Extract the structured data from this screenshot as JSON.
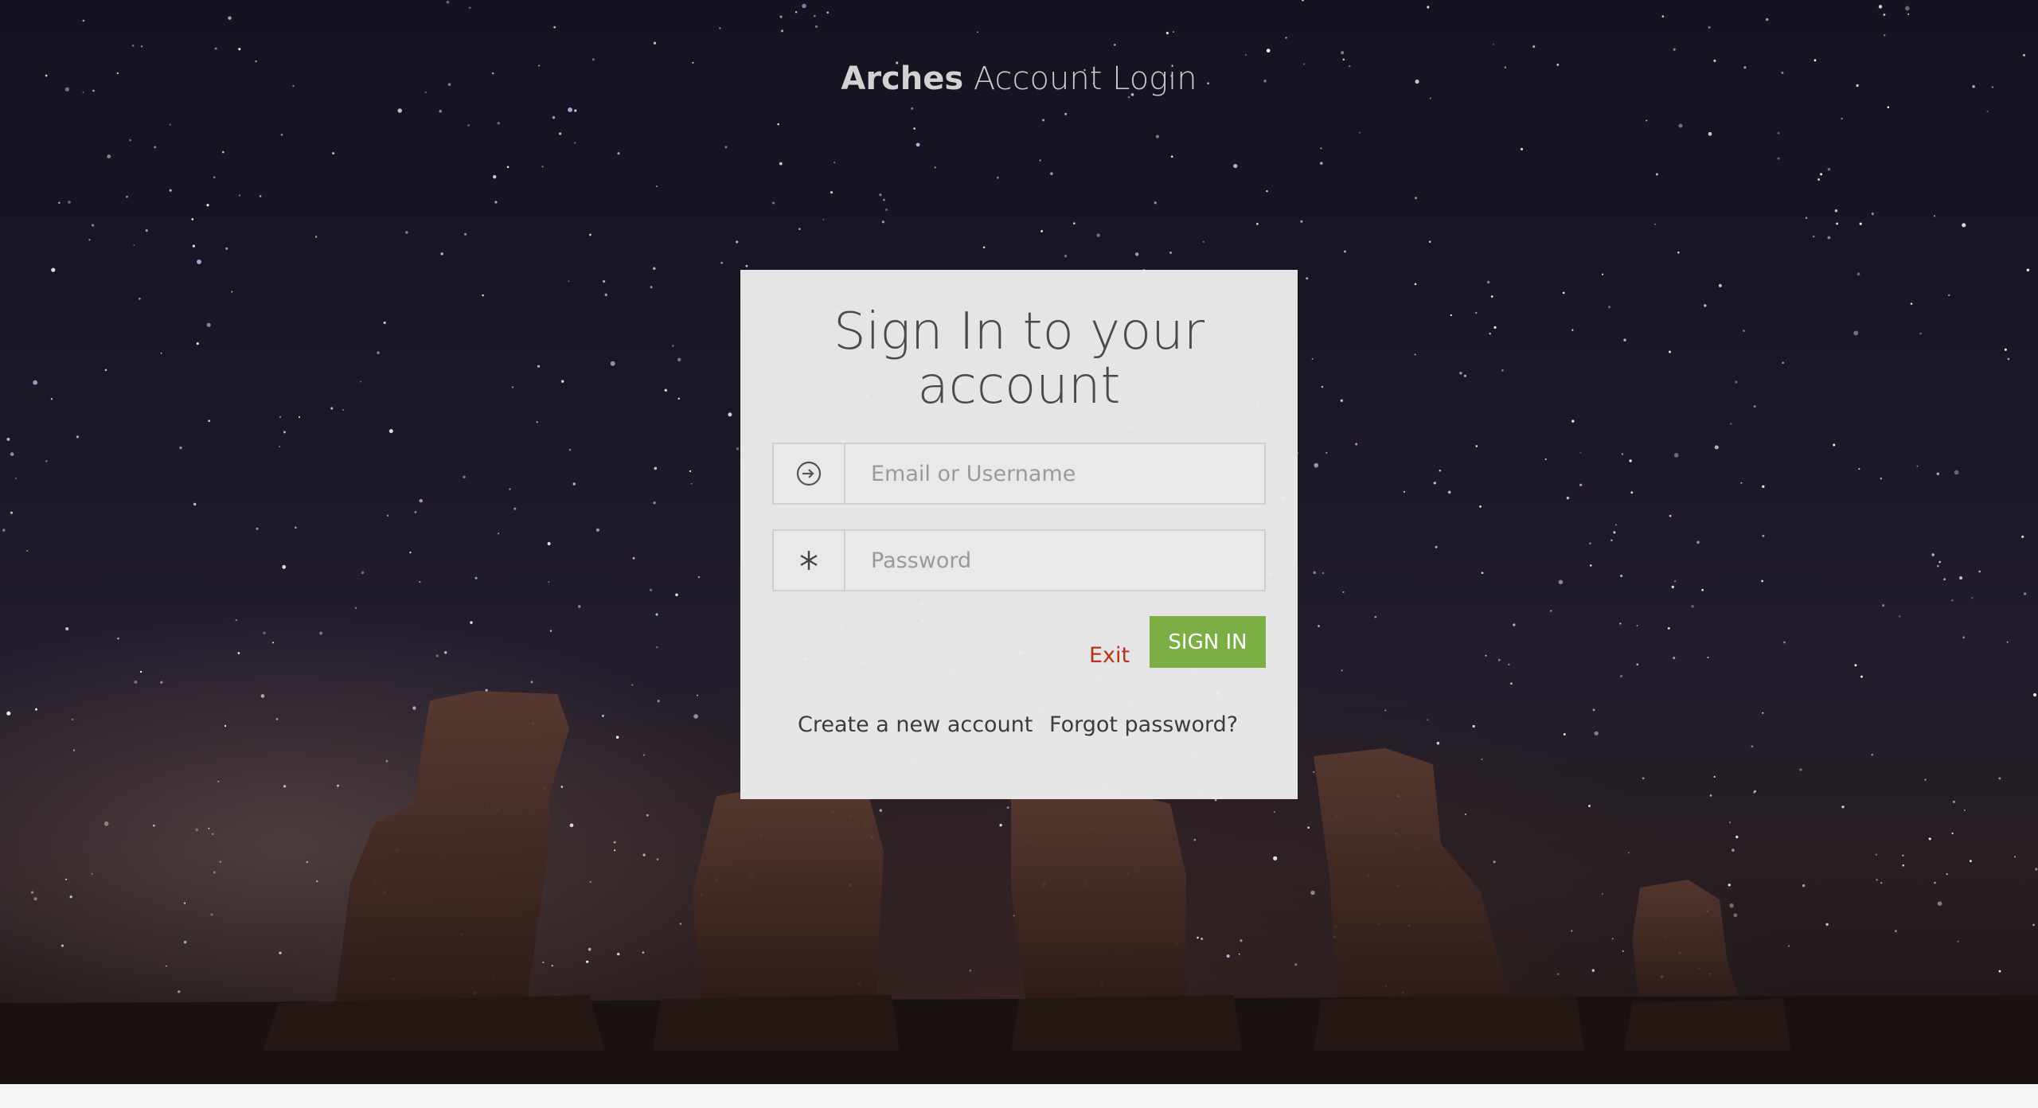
{
  "header": {
    "brand": "Arches",
    "title": "Account Login"
  },
  "login_card": {
    "heading": "Sign In to your account",
    "username_field": {
      "placeholder": "Email or Username",
      "value": "",
      "icon": "sign-in-icon"
    },
    "password_field": {
      "placeholder": "Password",
      "value": "",
      "icon": "asterisk-icon"
    },
    "exit_label": "Exit",
    "signin_label": "SIGN IN",
    "create_account_label": "Create a new account",
    "forgot_password_label": "Forgot password?"
  },
  "colors": {
    "signin_button": "#7cae46",
    "exit_link": "#b83218",
    "card_background": "#ececec"
  }
}
